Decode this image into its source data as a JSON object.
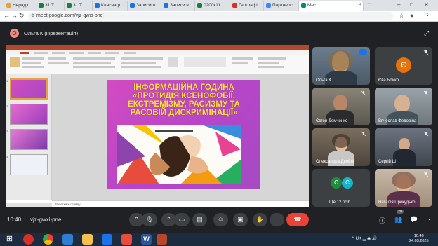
{
  "browser": {
    "tabs": [
      {
        "label": "Нерадз",
        "color": "#e8a23a"
      },
      {
        "label": "31 Т",
        "color": "#188038"
      },
      {
        "label": "31 Т",
        "color": "#188038"
      },
      {
        "label": "Класна р",
        "color": "#1a73e8"
      },
      {
        "label": "Записи ж",
        "color": "#1a73e8"
      },
      {
        "label": "Записи в",
        "color": "#1a73e8"
      },
      {
        "label": "0200к11",
        "color": "#188038"
      },
      {
        "label": "Географі",
        "color": "#d93025"
      },
      {
        "label": "Партнерс",
        "color": "#4285f4"
      },
      {
        "label": "Мес",
        "color": "#00897b"
      }
    ],
    "url": "meet.google.com/vjz-gwxi-pne"
  },
  "meet": {
    "presenter_label": "Ольга К (Презентація)",
    "clock": "10:40",
    "meeting_code": "vjz-gwxi-pne",
    "people_count": "20",
    "accent": "#ea4335"
  },
  "presentation": {
    "notes_placeholder": "Заметки к слайду",
    "slide_title": "ІНФОРМАЦІЙНА ГОДИНА «ПРОТИДІЯ КСЕНОФОБІЇ, ЕКСТРЕМІЗМУ, РАСИЗМУ ТА РАСОВІЙ ДИСКРИМІНАЦІЇ»",
    "title_color": "#ffe24a",
    "thumb_numbers": [
      "1",
      "2",
      "3",
      "4"
    ]
  },
  "participants": [
    {
      "name": "Ольга К",
      "kind": "video-woman"
    },
    {
      "name": "Єва Бойко",
      "kind": "letter",
      "letter": "Є",
      "avatar_color": "#e8710a"
    },
    {
      "name": "Євген Демченко",
      "kind": "video-man"
    },
    {
      "name": "Вячеслав Федоріна",
      "kind": "video-man2"
    },
    {
      "name": "Олександра Двойні",
      "kind": "video-girl"
    },
    {
      "name": "Сергій Ш",
      "kind": "video-boy"
    },
    {
      "name": "Ще 12 осіб",
      "kind": "more",
      "letters": [
        "С",
        "С"
      ],
      "avatar_color": "#1e8e3e"
    },
    {
      "name": "Наталія Прокудько",
      "kind": "video-woman2"
    }
  ],
  "taskbar": {
    "lang": "UK",
    "time": "10:40",
    "date": "24.03.2025"
  }
}
